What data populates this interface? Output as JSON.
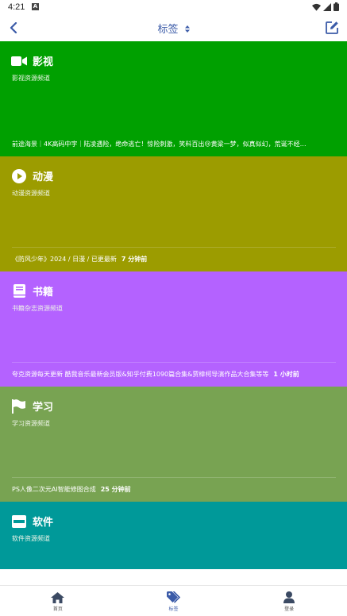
{
  "status": {
    "time": "4:21"
  },
  "header": {
    "title": "标签"
  },
  "colors": {
    "accent": "#3b5ba8",
    "card_movies": "#00a000",
    "card_anime": "#9c9c00",
    "card_books": "#b462ff",
    "card_study": "#78a352",
    "card_software": "#009999"
  },
  "cards": [
    {
      "icon": "video-camera-icon",
      "title": "影视",
      "subtitle": "影视资源频道",
      "latest": "前途海景｜4K高码中字｜陆凌遇险，绝命逃亡！惊险刺激，笑料百出😢黄粱一梦，似真似幻，荒诞不经…",
      "time": ""
    },
    {
      "icon": "play-circle-icon",
      "title": "动漫",
      "subtitle": "动漫资源频道",
      "latest": "《防风少年》2024 / 日漫 / 已更最新",
      "time": "7 分钟前"
    },
    {
      "icon": "book-icon",
      "title": "书籍",
      "subtitle": "书籍杂志资源频道",
      "latest": "夸克资源每天更新 酷我音乐最新会员版&知乎付费1090篇合集&贾樟柯导演作品大合集等等",
      "time": "1 小时前"
    },
    {
      "icon": "flag-icon",
      "title": "学习",
      "subtitle": "学习资源频道",
      "latest": "PS人像二次元AI智能修图合成",
      "time": "25 分钟前"
    },
    {
      "icon": "window-icon",
      "title": "软件",
      "subtitle": "软件资源频道",
      "latest": "",
      "time": ""
    }
  ],
  "nav": [
    {
      "icon": "home-icon",
      "label": "首页"
    },
    {
      "icon": "tags-icon",
      "label": "标签"
    },
    {
      "icon": "user-icon",
      "label": "登录"
    }
  ]
}
